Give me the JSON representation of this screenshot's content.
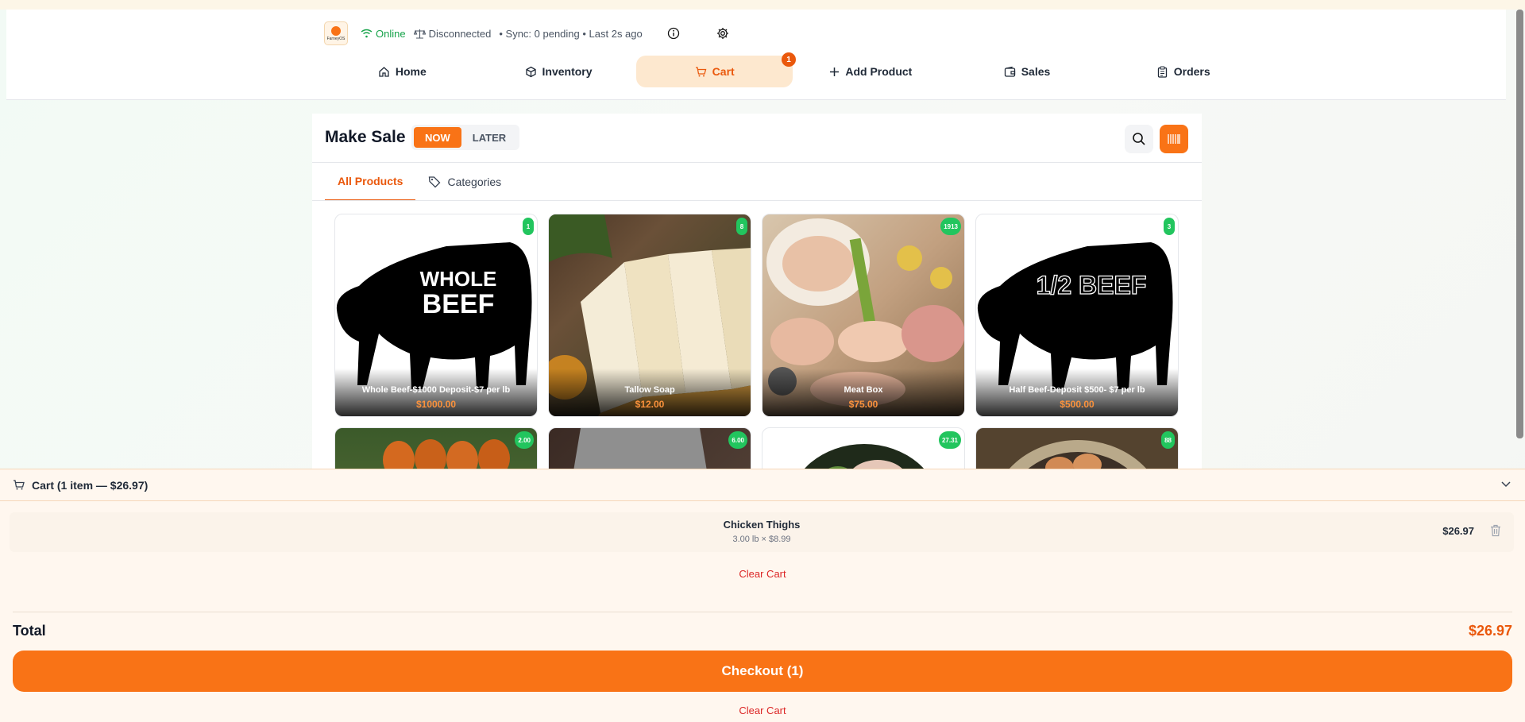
{
  "status": {
    "logo_text": "FarneyOS",
    "online": "Online",
    "connection": "Disconnected",
    "sync": "• Sync: 0 pending • Last 2s ago"
  },
  "nav": {
    "items": [
      {
        "label": "Home",
        "icon": "home-icon"
      },
      {
        "label": "Inventory",
        "icon": "box-icon"
      },
      {
        "label": "Cart",
        "icon": "cart-icon",
        "badge": "1",
        "active": true
      },
      {
        "label": "Add Product",
        "icon": "plus-icon"
      },
      {
        "label": "Sales",
        "icon": "wallet-icon"
      },
      {
        "label": "Orders",
        "icon": "clipboard-icon"
      }
    ]
  },
  "sale": {
    "title": "Make Sale",
    "toggle_now": "NOW",
    "toggle_later": "LATER"
  },
  "tabs": {
    "all": "All Products",
    "categories": "Categories"
  },
  "products": [
    {
      "name": "Whole Beef-$1000 Deposit-$7 per lb",
      "price": "$1000.00",
      "stock": "1",
      "image_text_1": "WHOLE",
      "image_text_2": "BEEF"
    },
    {
      "name": "Tallow Soap",
      "price": "$12.00",
      "stock": "8"
    },
    {
      "name": "Meat Box",
      "price": "$75.00",
      "stock": "1913"
    },
    {
      "name": "Half Beef-Deposit $500- $7 per lb",
      "price": "$500.00",
      "stock": "3",
      "image_text_1": "1/2 BEEF"
    },
    {
      "stock": "2.00"
    },
    {
      "stock": "6.00"
    },
    {
      "stock": "27.31"
    },
    {
      "stock": "88"
    }
  ],
  "cart": {
    "header": "Cart (1 item — $26.97)",
    "items": [
      {
        "name": "Chicken Thighs",
        "qty": "3.00 lb × $8.99",
        "total": "$26.97"
      }
    ],
    "clear": "Clear Cart",
    "total_label": "Total",
    "total_value": "$26.97",
    "checkout": "Checkout (1)"
  },
  "colors": {
    "accent": "#f97316",
    "online": "#16a34a",
    "stock_badge": "#22c55e",
    "danger": "#dc2626"
  }
}
